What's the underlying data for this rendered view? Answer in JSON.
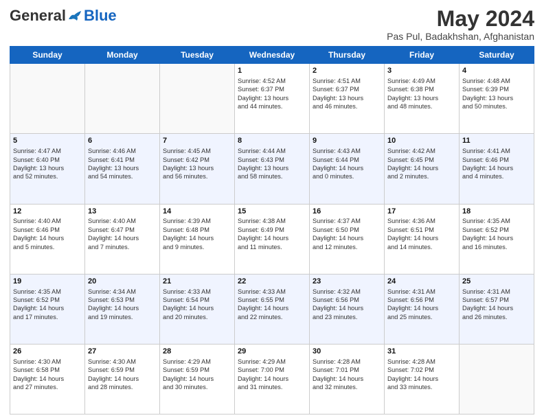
{
  "header": {
    "logo_general": "General",
    "logo_blue": "Blue",
    "title": "May 2024",
    "location": "Pas Pul, Badakhshan, Afghanistan"
  },
  "days_of_week": [
    "Sunday",
    "Monday",
    "Tuesday",
    "Wednesday",
    "Thursday",
    "Friday",
    "Saturday"
  ],
  "weeks": [
    [
      {
        "day": "",
        "content": ""
      },
      {
        "day": "",
        "content": ""
      },
      {
        "day": "",
        "content": ""
      },
      {
        "day": "1",
        "content": "Sunrise: 4:52 AM\nSunset: 6:37 PM\nDaylight: 13 hours\nand 44 minutes."
      },
      {
        "day": "2",
        "content": "Sunrise: 4:51 AM\nSunset: 6:37 PM\nDaylight: 13 hours\nand 46 minutes."
      },
      {
        "day": "3",
        "content": "Sunrise: 4:49 AM\nSunset: 6:38 PM\nDaylight: 13 hours\nand 48 minutes."
      },
      {
        "day": "4",
        "content": "Sunrise: 4:48 AM\nSunset: 6:39 PM\nDaylight: 13 hours\nand 50 minutes."
      }
    ],
    [
      {
        "day": "5",
        "content": "Sunrise: 4:47 AM\nSunset: 6:40 PM\nDaylight: 13 hours\nand 52 minutes."
      },
      {
        "day": "6",
        "content": "Sunrise: 4:46 AM\nSunset: 6:41 PM\nDaylight: 13 hours\nand 54 minutes."
      },
      {
        "day": "7",
        "content": "Sunrise: 4:45 AM\nSunset: 6:42 PM\nDaylight: 13 hours\nand 56 minutes."
      },
      {
        "day": "8",
        "content": "Sunrise: 4:44 AM\nSunset: 6:43 PM\nDaylight: 13 hours\nand 58 minutes."
      },
      {
        "day": "9",
        "content": "Sunrise: 4:43 AM\nSunset: 6:44 PM\nDaylight: 14 hours\nand 0 minutes."
      },
      {
        "day": "10",
        "content": "Sunrise: 4:42 AM\nSunset: 6:45 PM\nDaylight: 14 hours\nand 2 minutes."
      },
      {
        "day": "11",
        "content": "Sunrise: 4:41 AM\nSunset: 6:46 PM\nDaylight: 14 hours\nand 4 minutes."
      }
    ],
    [
      {
        "day": "12",
        "content": "Sunrise: 4:40 AM\nSunset: 6:46 PM\nDaylight: 14 hours\nand 5 minutes."
      },
      {
        "day": "13",
        "content": "Sunrise: 4:40 AM\nSunset: 6:47 PM\nDaylight: 14 hours\nand 7 minutes."
      },
      {
        "day": "14",
        "content": "Sunrise: 4:39 AM\nSunset: 6:48 PM\nDaylight: 14 hours\nand 9 minutes."
      },
      {
        "day": "15",
        "content": "Sunrise: 4:38 AM\nSunset: 6:49 PM\nDaylight: 14 hours\nand 11 minutes."
      },
      {
        "day": "16",
        "content": "Sunrise: 4:37 AM\nSunset: 6:50 PM\nDaylight: 14 hours\nand 12 minutes."
      },
      {
        "day": "17",
        "content": "Sunrise: 4:36 AM\nSunset: 6:51 PM\nDaylight: 14 hours\nand 14 minutes."
      },
      {
        "day": "18",
        "content": "Sunrise: 4:35 AM\nSunset: 6:52 PM\nDaylight: 14 hours\nand 16 minutes."
      }
    ],
    [
      {
        "day": "19",
        "content": "Sunrise: 4:35 AM\nSunset: 6:52 PM\nDaylight: 14 hours\nand 17 minutes."
      },
      {
        "day": "20",
        "content": "Sunrise: 4:34 AM\nSunset: 6:53 PM\nDaylight: 14 hours\nand 19 minutes."
      },
      {
        "day": "21",
        "content": "Sunrise: 4:33 AM\nSunset: 6:54 PM\nDaylight: 14 hours\nand 20 minutes."
      },
      {
        "day": "22",
        "content": "Sunrise: 4:33 AM\nSunset: 6:55 PM\nDaylight: 14 hours\nand 22 minutes."
      },
      {
        "day": "23",
        "content": "Sunrise: 4:32 AM\nSunset: 6:56 PM\nDaylight: 14 hours\nand 23 minutes."
      },
      {
        "day": "24",
        "content": "Sunrise: 4:31 AM\nSunset: 6:56 PM\nDaylight: 14 hours\nand 25 minutes."
      },
      {
        "day": "25",
        "content": "Sunrise: 4:31 AM\nSunset: 6:57 PM\nDaylight: 14 hours\nand 26 minutes."
      }
    ],
    [
      {
        "day": "26",
        "content": "Sunrise: 4:30 AM\nSunset: 6:58 PM\nDaylight: 14 hours\nand 27 minutes."
      },
      {
        "day": "27",
        "content": "Sunrise: 4:30 AM\nSunset: 6:59 PM\nDaylight: 14 hours\nand 28 minutes."
      },
      {
        "day": "28",
        "content": "Sunrise: 4:29 AM\nSunset: 6:59 PM\nDaylight: 14 hours\nand 30 minutes."
      },
      {
        "day": "29",
        "content": "Sunrise: 4:29 AM\nSunset: 7:00 PM\nDaylight: 14 hours\nand 31 minutes."
      },
      {
        "day": "30",
        "content": "Sunrise: 4:28 AM\nSunset: 7:01 PM\nDaylight: 14 hours\nand 32 minutes."
      },
      {
        "day": "31",
        "content": "Sunrise: 4:28 AM\nSunset: 7:02 PM\nDaylight: 14 hours\nand 33 minutes."
      },
      {
        "day": "",
        "content": ""
      }
    ]
  ]
}
